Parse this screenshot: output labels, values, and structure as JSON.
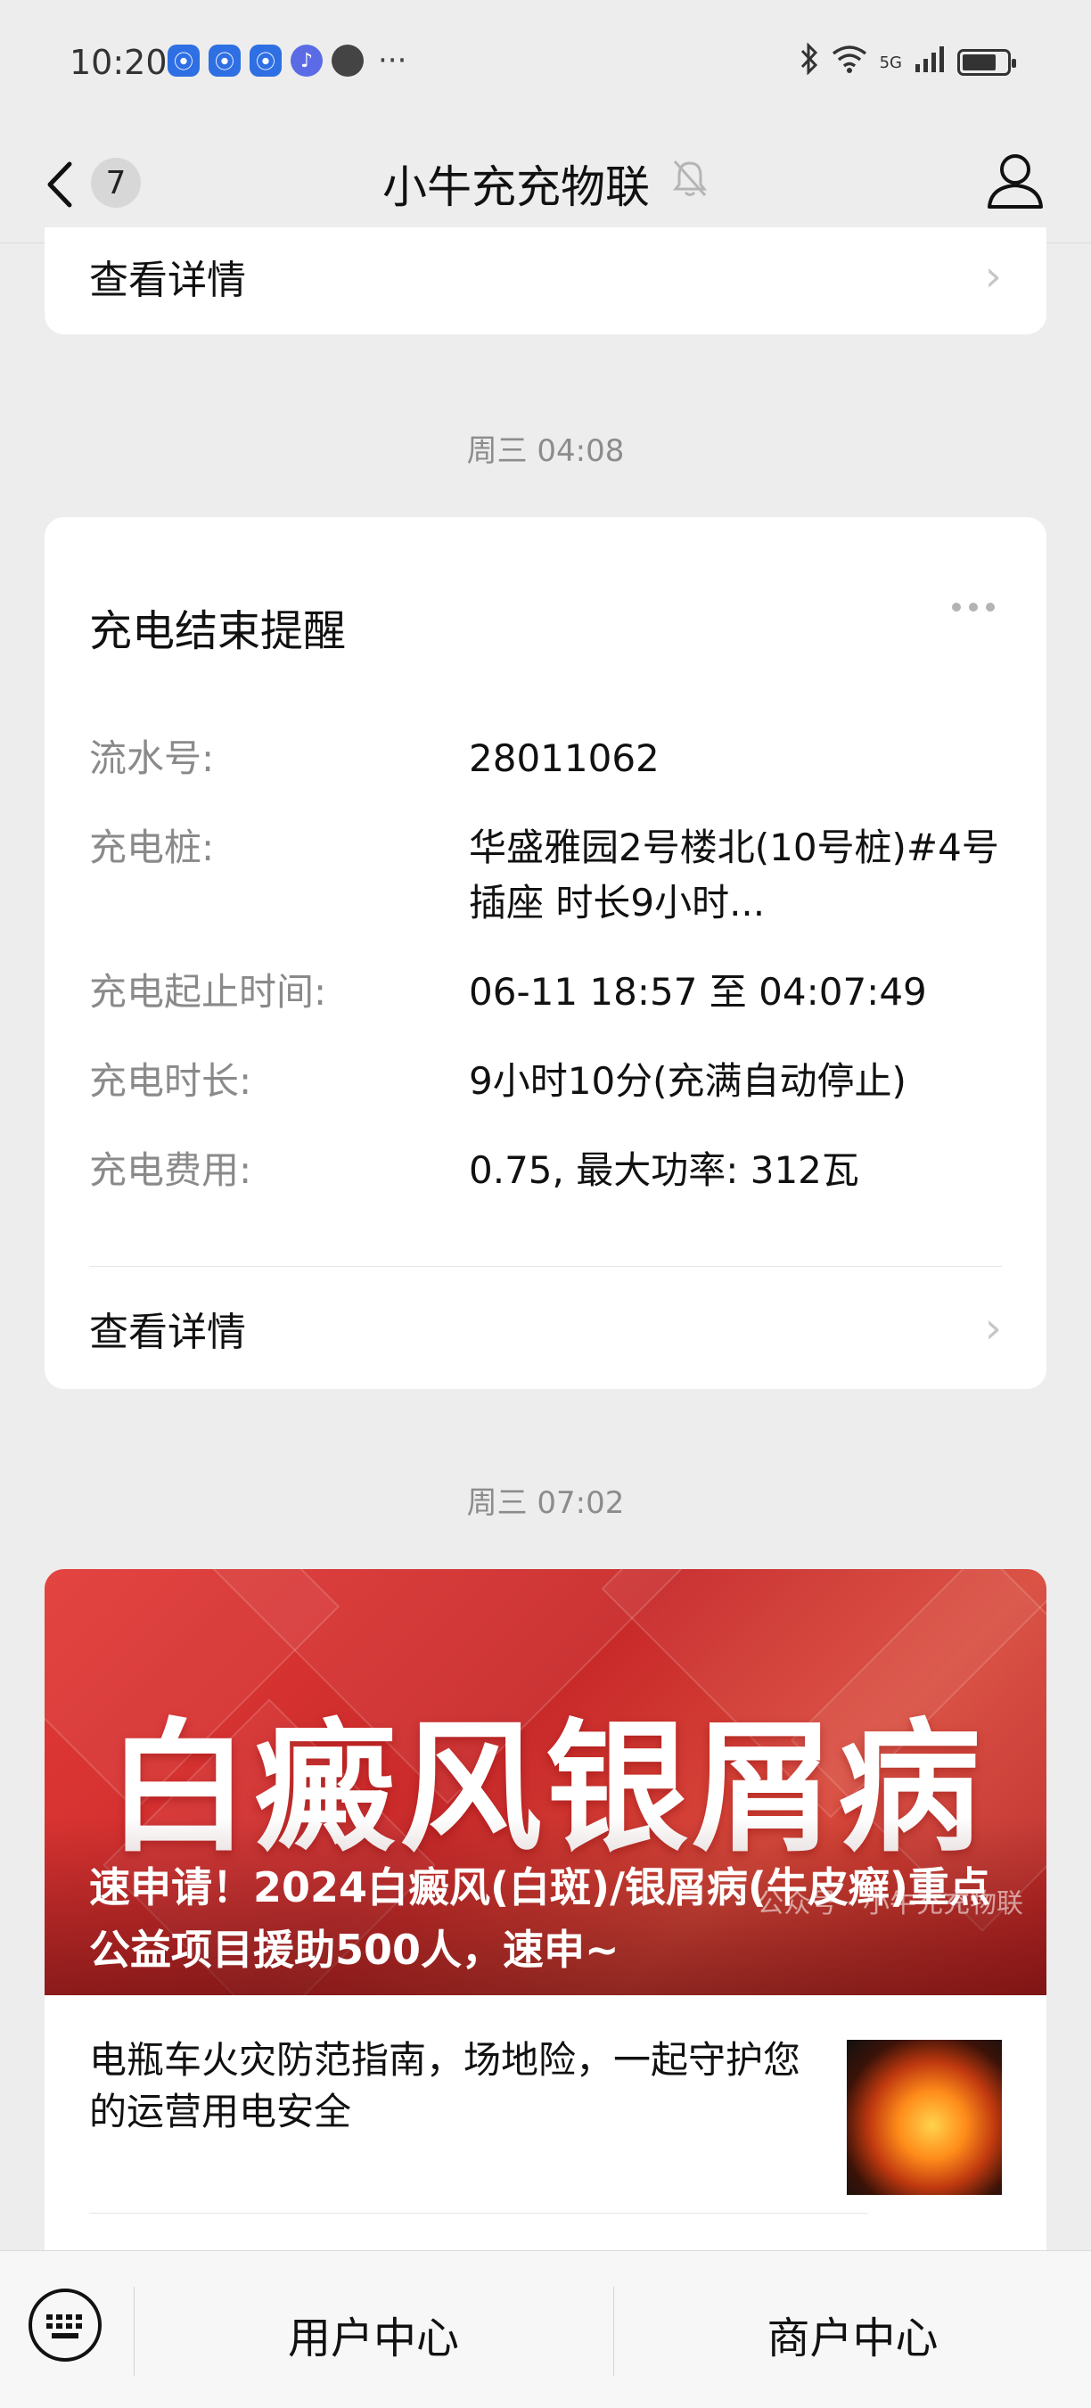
{
  "status_bar": {
    "time": "10:20",
    "more": "···",
    "network": "5G",
    "battery_level_pct": 80,
    "icons": [
      "baidu-icon",
      "baidu-icon",
      "baidu-icon",
      "music-icon",
      "chat-icon",
      "bluetooth-icon",
      "wifi-icon",
      "signal-icon",
      "battery-icon"
    ]
  },
  "nav": {
    "badge_count": "7",
    "title": "小牛充充物联",
    "icons": [
      "back-icon",
      "mute-bell-icon",
      "profile-icon"
    ]
  },
  "card1": {
    "link_label": "查看详情"
  },
  "timestamp1": "周三 04:08",
  "card2": {
    "title": "充电结束提醒",
    "rows": [
      {
        "label": "流水号:",
        "value": "28011062"
      },
      {
        "label": "充电桩:",
        "value": "华盛雅园2号楼北(10号桩)#4号插座 时长9小时..."
      },
      {
        "label": "充电起止时间:",
        "value": "06-11 18:57 至 04:07:49"
      },
      {
        "label": "充电时长:",
        "value": "9小时10分(充满自动停止)"
      },
      {
        "label": "充电费用:",
        "value": "0.75, 最大功率: 312瓦"
      }
    ],
    "link_label": "查看详情"
  },
  "timestamp2": "周三 07:02",
  "article": {
    "banner_text": "白癜风银屑病",
    "title": "速申请！2024白癜风(白斑)/银屑病(牛皮癣)重点公益项目援助500人，速申~",
    "watermark": "公众号 · 小牛充充物联",
    "sub_item": "电瓶车火灾防范指南，场地险，一起守护您的运营用电安全"
  },
  "bottom_menu": {
    "items": [
      "用户中心",
      "商户中心"
    ],
    "icons": [
      "keyboard-icon"
    ]
  },
  "colors": {
    "background": "#ededed",
    "card": "#ffffff",
    "banner_red": "#d23030",
    "secondary_text": "#8a8a8a"
  }
}
